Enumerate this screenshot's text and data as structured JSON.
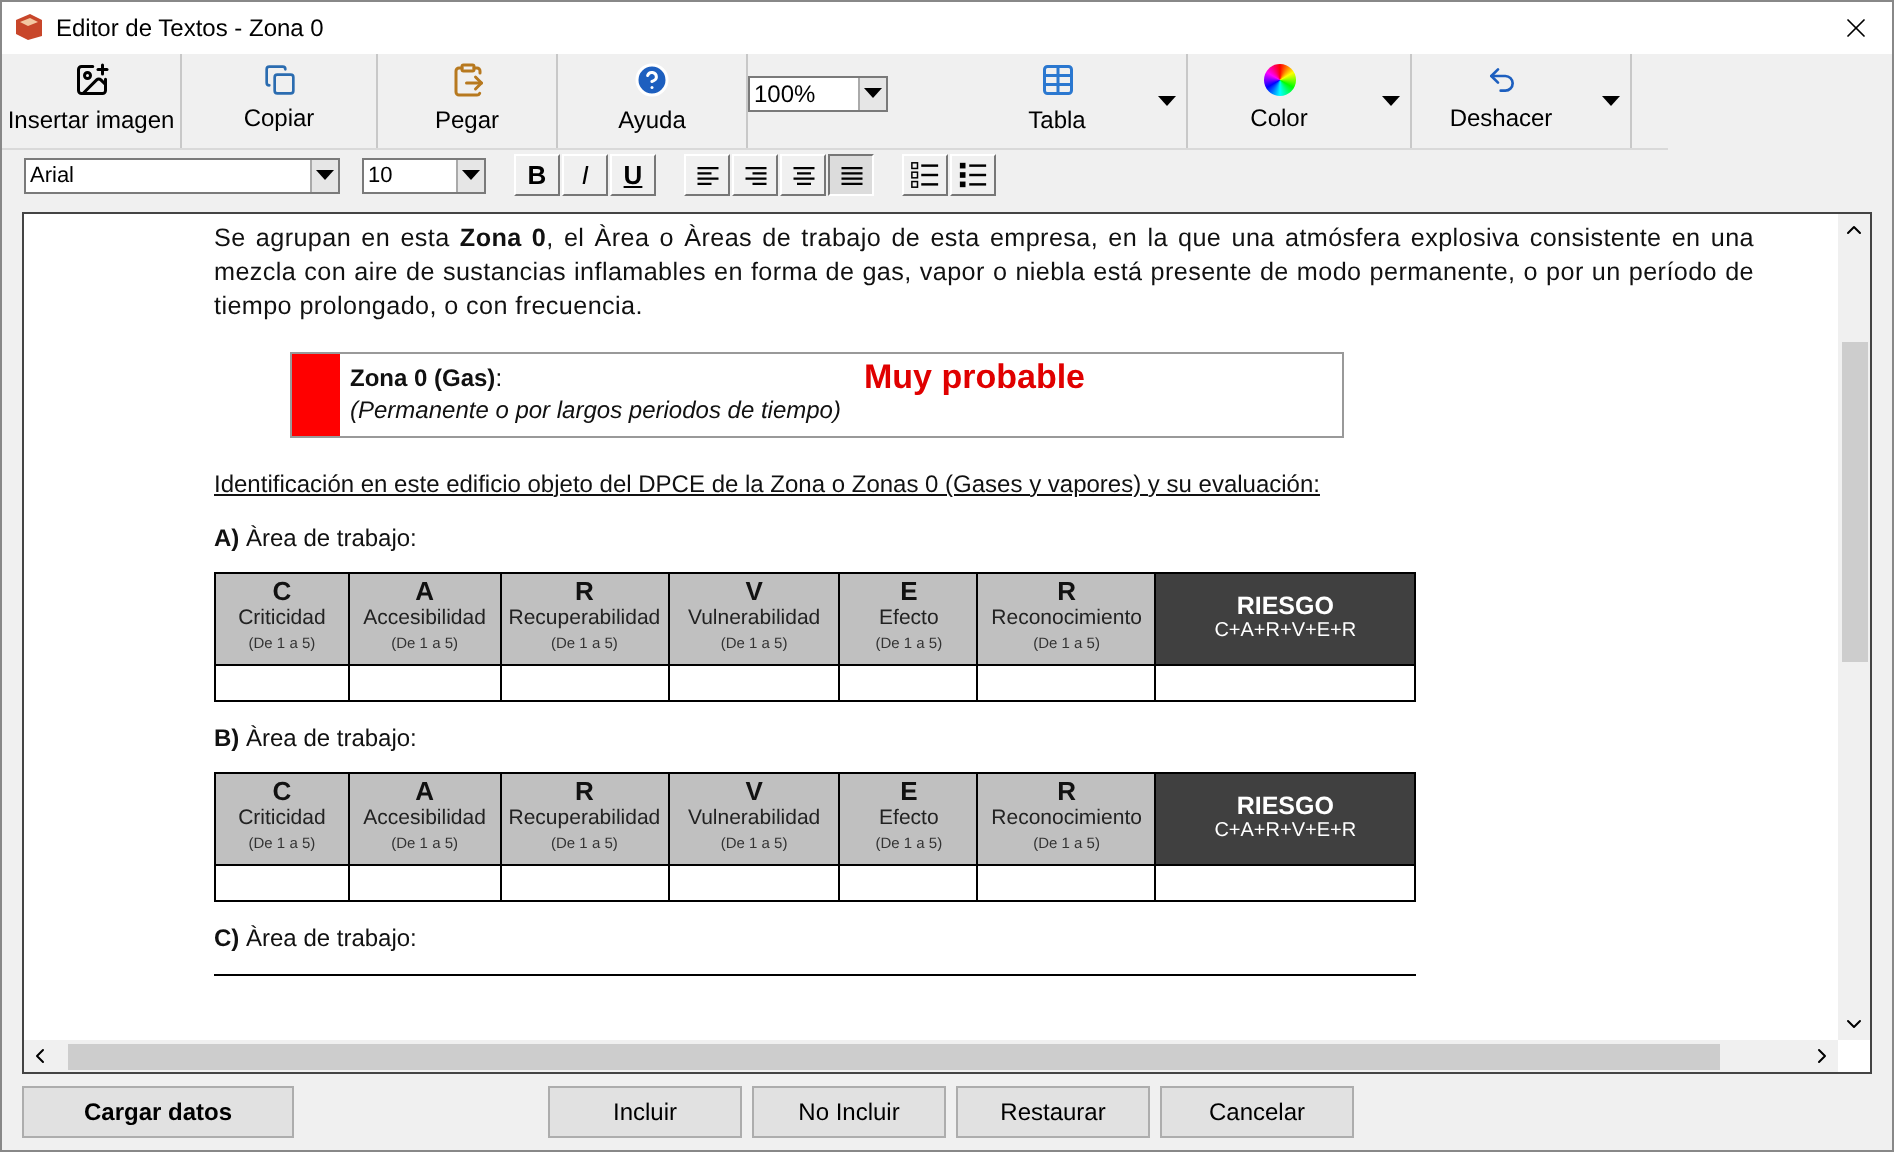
{
  "window": {
    "title": "Editor de Textos - Zona 0"
  },
  "toolbar": [
    {
      "kind": "image",
      "label": "Insertar imagen",
      "dropdown": false
    },
    {
      "kind": "copy",
      "label": "Copiar",
      "dropdown": false
    },
    {
      "kind": "paste",
      "label": "Pegar",
      "dropdown": false
    },
    {
      "kind": "help",
      "label": "Ayuda",
      "dropdown": false
    },
    {
      "kind": "zoom",
      "value": "100%"
    },
    {
      "kind": "table",
      "label": "Tabla",
      "dropdown": true
    },
    {
      "kind": "color",
      "label": "Color",
      "dropdown": true
    },
    {
      "kind": "undo",
      "label": "Deshacer",
      "dropdown": true
    }
  ],
  "format": {
    "font": "Arial",
    "size": "10",
    "buttons": [
      {
        "kind": "bold",
        "text": "B",
        "selected": false
      },
      {
        "kind": "italic",
        "text": "I",
        "selected": false
      },
      {
        "kind": "underline",
        "text": "U",
        "selected": false
      },
      {
        "kind": "align-left",
        "selected": false
      },
      {
        "kind": "align-right",
        "selected": false
      },
      {
        "kind": "align-center",
        "selected": false
      },
      {
        "kind": "justify",
        "selected": true
      },
      {
        "kind": "numbered-list",
        "selected": false
      },
      {
        "kind": "bulleted-list",
        "selected": false
      }
    ]
  },
  "document": {
    "paragraph": "Se agrupan en esta **Zona 0**, el Àrea o Àreas de trabajo de esta empresa, en la que una atmósfera explosiva consistente en una mezcla con aire de sustancias inflamables en forma de gas, vapor o niebla está presente de modo permanente, o por un período de tiempo prolongado, o con frecuencia.",
    "zone": {
      "title": "**Zona 0 (Gas)**:",
      "subtitle": "(Permanente o por largos periodos de tiempo)",
      "rating": "Muy probable",
      "color": "#ff0000"
    },
    "heading": "Identificación en este edificio objeto del DPCE de la Zona o Zonas 0 (Gases y vapores) y su evaluación:",
    "sections": [
      {
        "title": "**A)** Àrea de trabajo:",
        "has_table": true,
        "columns": [
          {
            "letter": "C",
            "name": "Criticidad",
            "range": "(De 1 a 5)",
            "kind": "factor"
          },
          {
            "letter": "A",
            "name": "Accesibilidad",
            "range": "(De 1 a 5)",
            "kind": "factor"
          },
          {
            "letter": "R",
            "name": "Recuperabilidad",
            "range": "(De 1 a 5)",
            "kind": "factor"
          },
          {
            "letter": "V",
            "name": "Vulnerabilidad",
            "range": "(De 1 a 5)",
            "kind": "factor"
          },
          {
            "letter": "E",
            "name": "Efecto",
            "range": "(De 1 a 5)",
            "kind": "factor"
          },
          {
            "letter": "R",
            "name": "Reconocimiento",
            "range": "(De 1 a 5)",
            "kind": "factor"
          },
          {
            "letter": "RIESGO",
            "name": "C+A+R+V+E+R",
            "kind": "total"
          }
        ]
      },
      {
        "title": "**B)** Àrea de trabajo:",
        "has_table": true,
        "columns": [
          {
            "letter": "C",
            "name": "Criticidad",
            "range": "(De 1 a 5)",
            "kind": "factor"
          },
          {
            "letter": "A",
            "name": "Accesibilidad",
            "range": "(De 1 a 5)",
            "kind": "factor"
          },
          {
            "letter": "R",
            "name": "Recuperabilidad",
            "range": "(De 1 a 5)",
            "kind": "factor"
          },
          {
            "letter": "V",
            "name": "Vulnerabilidad",
            "range": "(De 1 a 5)",
            "kind": "factor"
          },
          {
            "letter": "E",
            "name": "Efecto",
            "range": "(De 1 a 5)",
            "kind": "factor"
          },
          {
            "letter": "R",
            "name": "Reconocimiento",
            "range": "(De 1 a 5)",
            "kind": "factor"
          },
          {
            "letter": "RIESGO",
            "name": "C+A+R+V+E+R",
            "kind": "total"
          }
        ]
      },
      {
        "title": "**C)** Àrea de trabajo:",
        "has_table": false
      }
    ]
  },
  "buttons": [
    {
      "label": "Cargar datos",
      "kind": "primary"
    },
    {
      "label": "Incluir",
      "kind": "default"
    },
    {
      "label": "No Incluir",
      "kind": "default"
    },
    {
      "label": "Restaurar",
      "kind": "default"
    },
    {
      "label": "Cancelar",
      "kind": "default"
    }
  ]
}
